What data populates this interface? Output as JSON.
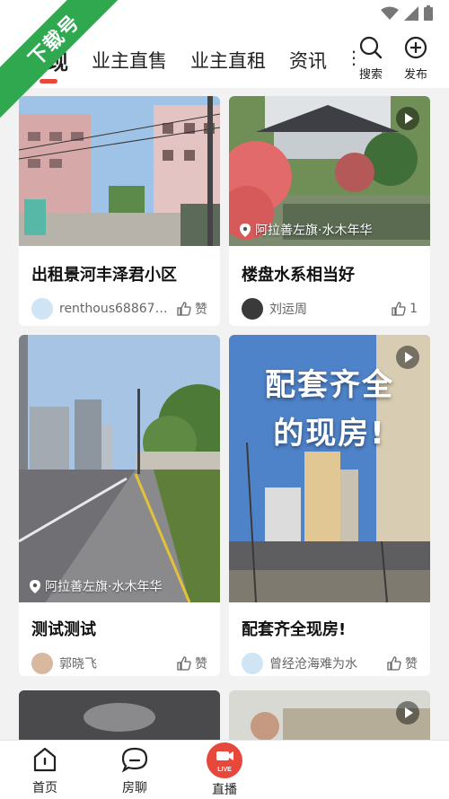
{
  "ribbon": {
    "label": "下载号"
  },
  "nav": {
    "tabs": [
      {
        "label": "发现",
        "active": true
      },
      {
        "label": "业主直售",
        "active": false
      },
      {
        "label": "业主直租",
        "active": false
      },
      {
        "label": "资讯",
        "active": false
      }
    ],
    "more_icon": "more-vertical-icon",
    "search_label": "搜索",
    "publish_label": "发布"
  },
  "colors": {
    "accent": "#e8473b",
    "ribbon_green": "#2fa84f"
  },
  "feed": {
    "cards": [
      {
        "title": "出租景河丰泽君小区",
        "author": "renthous68867…",
        "like_label": "赞",
        "location": "",
        "has_video": false
      },
      {
        "title": "楼盘水系相当好",
        "author": "刘运周",
        "like_label": "1",
        "location": "阿拉善左旗·水木年华",
        "has_video": true
      },
      {
        "title": "测试测试",
        "author": "郭晓飞",
        "like_label": "赞",
        "location": "阿拉善左旗·水木年华",
        "has_video": false
      },
      {
        "title": "配套齐全现房!",
        "author": "曾经沧海难为水",
        "like_label": "赞",
        "location": "",
        "has_video": true,
        "overlay_line1": "配套齐全",
        "overlay_line2": "的现房!"
      }
    ]
  },
  "bottom_nav": {
    "items": [
      {
        "label": "首页",
        "icon": "home-icon"
      },
      {
        "label": "房聊",
        "icon": "chat-bubble-icon"
      },
      {
        "label": "直播",
        "icon": "live-icon",
        "badge": "LIVE"
      }
    ]
  }
}
